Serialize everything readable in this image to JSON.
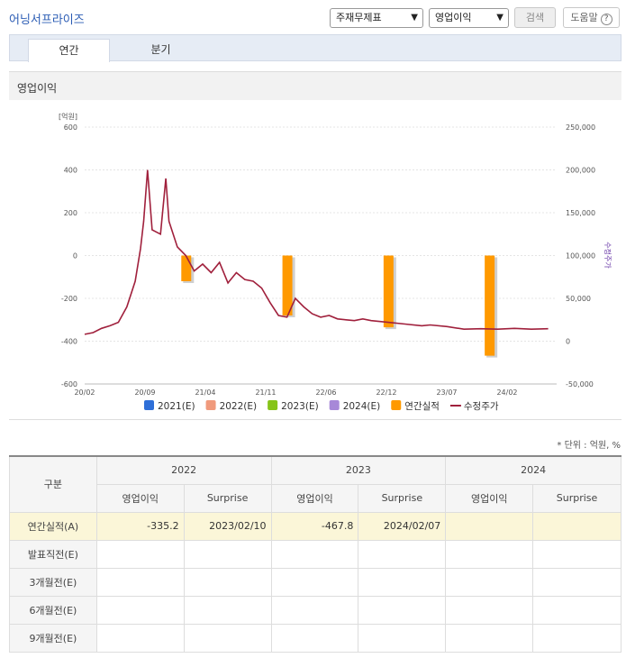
{
  "header": {
    "company": "어닝서프라이즈",
    "select_category": "주재무제표",
    "select_metric": "영업이익",
    "search_label": "검색",
    "help_label": "도움말",
    "help_glyph": "?"
  },
  "tabs": [
    {
      "label": "연간",
      "active": true
    },
    {
      "label": "분기",
      "active": false
    }
  ],
  "section_title": "영업이익",
  "chart_data": {
    "type": "bar+line",
    "left_axis_label": "[억원]",
    "right_axis_label": "수정주가",
    "y_left_ticks": [
      "600",
      "400",
      "200",
      "0",
      "-200",
      "-400",
      "-600"
    ],
    "y_left_range": [
      -600,
      600
    ],
    "y_right_ticks": [
      "250,000",
      "200,000",
      "150,000",
      "100,000",
      "50,000",
      "0",
      "-50,000"
    ],
    "y_right_range": [
      -50000,
      250000
    ],
    "x_ticks": [
      "20/02",
      "20/09",
      "21/04",
      "21/11",
      "22/06",
      "22/12",
      "23/07",
      "24/02"
    ],
    "bars": [
      {
        "date": "2021/02",
        "value": -120
      },
      {
        "date": "2022/02",
        "value": -280
      },
      {
        "date": "2023/02",
        "value": -335.2
      },
      {
        "date": "2024/02",
        "value": -467.8
      }
    ],
    "bar_color": "#ff9900",
    "line_color": "#a0203c",
    "price_series": [
      [
        "2020/02",
        8000
      ],
      [
        "2020/03",
        10000
      ],
      [
        "2020/04",
        15000
      ],
      [
        "2020/05",
        18000
      ],
      [
        "2020/06",
        22000
      ],
      [
        "2020/07",
        40000
      ],
      [
        "2020/08",
        70000
      ],
      [
        "2020/08/20",
        108000
      ],
      [
        "2020/09",
        140000
      ],
      [
        "2020/09/15",
        200000
      ],
      [
        "2020/10",
        130000
      ],
      [
        "2020/11",
        125000
      ],
      [
        "2020/11/20",
        190000
      ],
      [
        "2020/12",
        140000
      ],
      [
        "2021/01",
        110000
      ],
      [
        "2021/02",
        100000
      ],
      [
        "2021/03",
        82000
      ],
      [
        "2021/04",
        90000
      ],
      [
        "2021/05",
        80000
      ],
      [
        "2021/06",
        92000
      ],
      [
        "2021/07",
        68000
      ],
      [
        "2021/08",
        80000
      ],
      [
        "2021/09",
        72000
      ],
      [
        "2021/10",
        70000
      ],
      [
        "2021/11",
        62000
      ],
      [
        "2021/12",
        45000
      ],
      [
        "2022/01",
        30000
      ],
      [
        "2022/02",
        28000
      ],
      [
        "2022/03",
        50000
      ],
      [
        "2022/04",
        40000
      ],
      [
        "2022/05",
        32000
      ],
      [
        "2022/06",
        28000
      ],
      [
        "2022/07",
        30000
      ],
      [
        "2022/08",
        26000
      ],
      [
        "2022/09",
        25000
      ],
      [
        "2022/10",
        24000
      ],
      [
        "2022/11",
        26000
      ],
      [
        "2022/12",
        24000
      ],
      [
        "2023/02",
        22000
      ],
      [
        "2023/04",
        20000
      ],
      [
        "2023/06",
        18000
      ],
      [
        "2023/07",
        19000
      ],
      [
        "2023/09",
        17000
      ],
      [
        "2023/11",
        14000
      ],
      [
        "2024/01",
        14500
      ],
      [
        "2024/03",
        14000
      ],
      [
        "2024/05",
        15000
      ],
      [
        "2024/07",
        14000
      ],
      [
        "2024/09",
        14500
      ]
    ],
    "legend": [
      {
        "label": "2021(E)",
        "color": "#2e6fd8",
        "kind": "box"
      },
      {
        "label": "2022(E)",
        "color": "#f09a7c",
        "kind": "box"
      },
      {
        "label": "2023(E)",
        "color": "#86c419",
        "kind": "box"
      },
      {
        "label": "2024(E)",
        "color": "#a788d8",
        "kind": "box"
      },
      {
        "label": "연간실적",
        "color": "#ff9900",
        "kind": "box"
      },
      {
        "label": "수정주가",
        "color": "#a0203c",
        "kind": "line"
      }
    ]
  },
  "unit_note": "* 단위 : 억원, %",
  "table": {
    "corner": "구분",
    "years": [
      "2022",
      "2023",
      "2024"
    ],
    "subheaders": [
      "영업이익",
      "Surprise"
    ],
    "rows": [
      {
        "label": "연간실적(A)",
        "cells": [
          "-335.2",
          "2023/02/10",
          "-467.8",
          "2024/02/07",
          "",
          ""
        ],
        "highlight": true
      },
      {
        "label": "발표직전(E)",
        "cells": [
          "",
          "",
          "",
          "",
          "",
          ""
        ]
      },
      {
        "label": "3개월전(E)",
        "cells": [
          "",
          "",
          "",
          "",
          "",
          ""
        ]
      },
      {
        "label": "6개월전(E)",
        "cells": [
          "",
          "",
          "",
          "",
          "",
          ""
        ]
      },
      {
        "label": "9개월전(E)",
        "cells": [
          "",
          "",
          "",
          "",
          "",
          ""
        ]
      }
    ]
  }
}
